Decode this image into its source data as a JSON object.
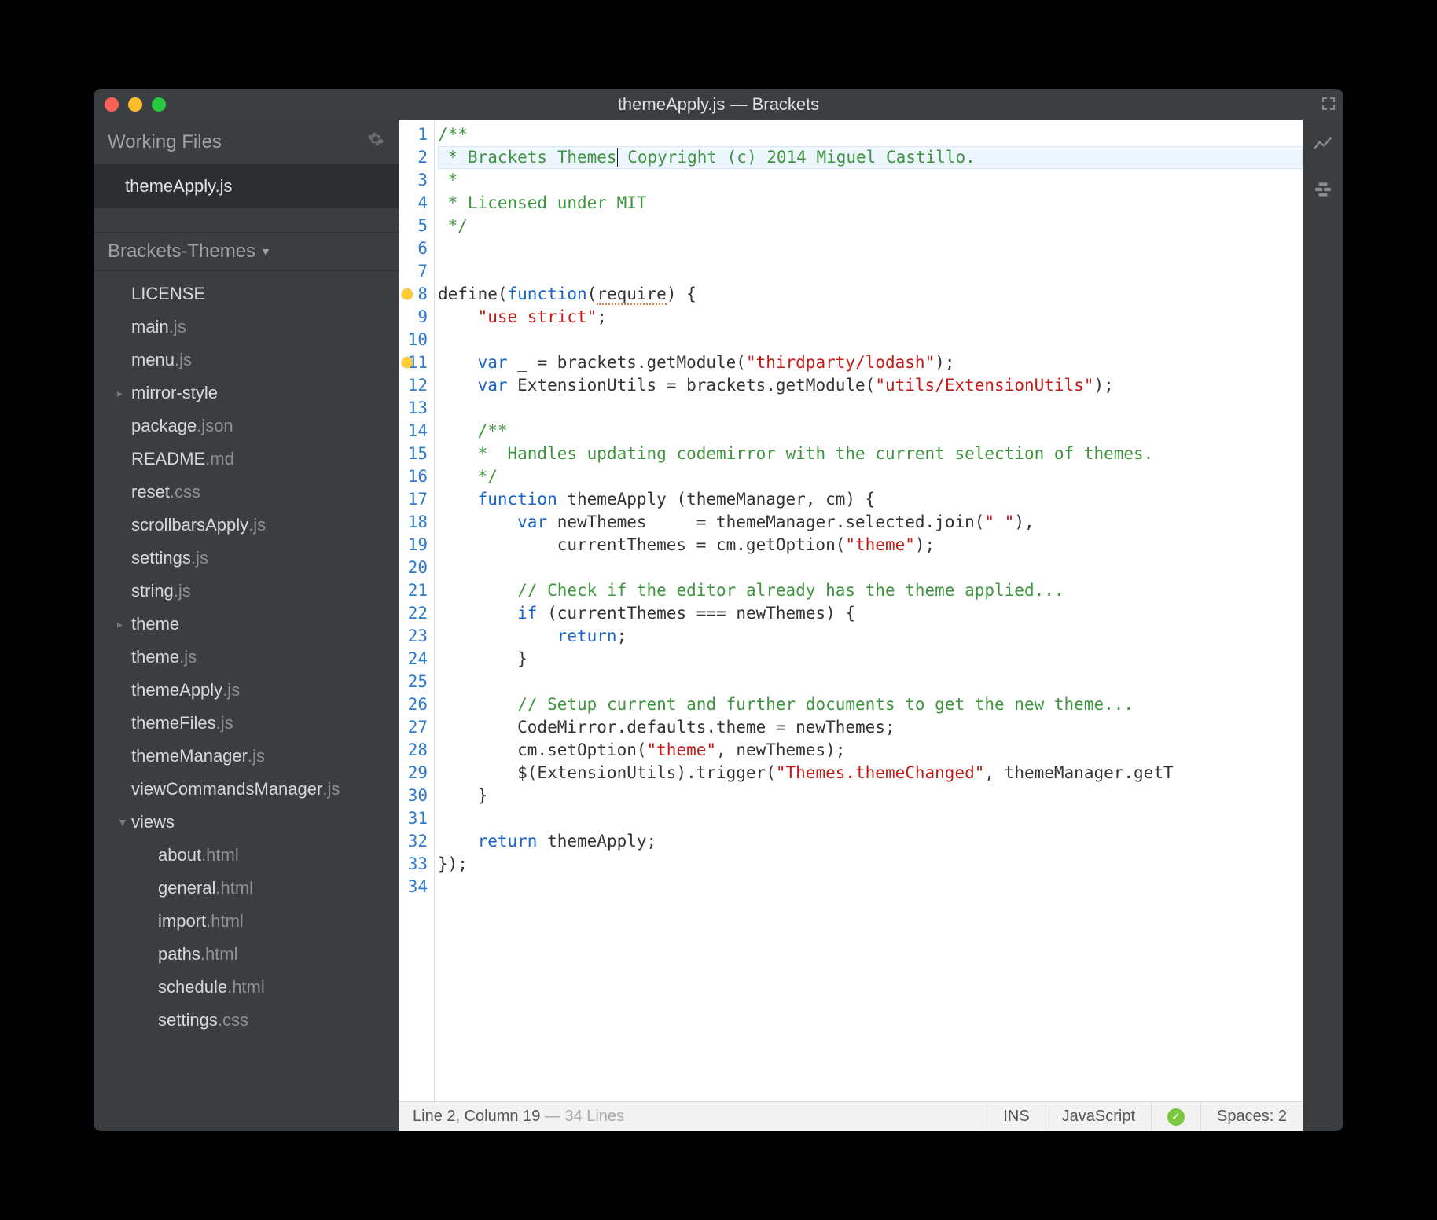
{
  "window": {
    "title": "themeApply.js — Brackets"
  },
  "working": {
    "header": "Working Files",
    "file": "themeApply.js"
  },
  "project": {
    "name": "Brackets-Themes"
  },
  "tree": [
    {
      "type": "file",
      "base": "LICENSE",
      "ext": "",
      "depth": 1
    },
    {
      "type": "file",
      "base": "main",
      "ext": ".js",
      "depth": 1
    },
    {
      "type": "file",
      "base": "menu",
      "ext": ".js",
      "depth": 1
    },
    {
      "type": "folder",
      "base": "mirror-style",
      "ext": "",
      "depth": 1,
      "state": "collapsed"
    },
    {
      "type": "file",
      "base": "package",
      "ext": ".json",
      "depth": 1
    },
    {
      "type": "file",
      "base": "README",
      "ext": ".md",
      "depth": 1
    },
    {
      "type": "file",
      "base": "reset",
      "ext": ".css",
      "depth": 1
    },
    {
      "type": "file",
      "base": "scrollbarsApply",
      "ext": ".js",
      "depth": 1
    },
    {
      "type": "file",
      "base": "settings",
      "ext": ".js",
      "depth": 1
    },
    {
      "type": "file",
      "base": "string",
      "ext": ".js",
      "depth": 1
    },
    {
      "type": "folder",
      "base": "theme",
      "ext": "",
      "depth": 1,
      "state": "collapsed"
    },
    {
      "type": "file",
      "base": "theme",
      "ext": ".js",
      "depth": 1
    },
    {
      "type": "file",
      "base": "themeApply",
      "ext": ".js",
      "depth": 1
    },
    {
      "type": "file",
      "base": "themeFiles",
      "ext": ".js",
      "depth": 1
    },
    {
      "type": "file",
      "base": "themeManager",
      "ext": ".js",
      "depth": 1
    },
    {
      "type": "file",
      "base": "viewCommandsManager",
      "ext": ".js",
      "depth": 1
    },
    {
      "type": "folder",
      "base": "views",
      "ext": "",
      "depth": 1,
      "state": "expanded"
    },
    {
      "type": "file",
      "base": "about",
      "ext": ".html",
      "depth": 2
    },
    {
      "type": "file",
      "base": "general",
      "ext": ".html",
      "depth": 2
    },
    {
      "type": "file",
      "base": "import",
      "ext": ".html",
      "depth": 2
    },
    {
      "type": "file",
      "base": "paths",
      "ext": ".html",
      "depth": 2
    },
    {
      "type": "file",
      "base": "schedule",
      "ext": ".html",
      "depth": 2
    },
    {
      "type": "file",
      "base": "settings",
      "ext": ".css",
      "depth": 2
    }
  ],
  "code": {
    "activeLine": 2,
    "hints": [
      8,
      11
    ],
    "lines": [
      {
        "n": 1,
        "t": [
          [
            "comment",
            "/**"
          ]
        ]
      },
      {
        "n": 2,
        "t": [
          [
            "comment",
            " * Brackets Themes"
          ],
          [
            "cursor",
            ""
          ],
          [
            "comment",
            " Copyright (c) 2014 Miguel Castillo."
          ]
        ]
      },
      {
        "n": 3,
        "t": [
          [
            "comment",
            " *"
          ]
        ]
      },
      {
        "n": 4,
        "t": [
          [
            "comment",
            " * Licensed under MIT"
          ]
        ]
      },
      {
        "n": 5,
        "t": [
          [
            "comment",
            " */"
          ]
        ]
      },
      {
        "n": 6,
        "t": []
      },
      {
        "n": 7,
        "t": []
      },
      {
        "n": 8,
        "t": [
          [
            "def",
            "define("
          ],
          [
            "kw",
            "function"
          ],
          [
            "def",
            "("
          ],
          [
            "spellerr",
            "require"
          ],
          [
            "def",
            ") {"
          ]
        ]
      },
      {
        "n": 9,
        "t": [
          [
            "def",
            "    "
          ],
          [
            "str",
            "\"use strict\""
          ],
          [
            "def",
            ";"
          ]
        ]
      },
      {
        "n": 10,
        "t": []
      },
      {
        "n": 11,
        "t": [
          [
            "def",
            "    "
          ],
          [
            "kw",
            "var"
          ],
          [
            "def",
            " _ = brackets.getModule("
          ],
          [
            "str",
            "\"thirdparty/lodash\""
          ],
          [
            "def",
            ");"
          ]
        ]
      },
      {
        "n": 12,
        "t": [
          [
            "def",
            "    "
          ],
          [
            "kw",
            "var"
          ],
          [
            "def",
            " ExtensionUtils = brackets.getModule("
          ],
          [
            "str",
            "\"utils/ExtensionUtils\""
          ],
          [
            "def",
            ");"
          ]
        ]
      },
      {
        "n": 13,
        "t": []
      },
      {
        "n": 14,
        "t": [
          [
            "def",
            "    "
          ],
          [
            "comment",
            "/**"
          ]
        ]
      },
      {
        "n": 15,
        "t": [
          [
            "def",
            "    "
          ],
          [
            "comment",
            "*  Handles updating codemirror with the current selection of themes."
          ]
        ]
      },
      {
        "n": 16,
        "t": [
          [
            "def",
            "    "
          ],
          [
            "comment",
            "*/"
          ]
        ]
      },
      {
        "n": 17,
        "t": [
          [
            "def",
            "    "
          ],
          [
            "kw",
            "function"
          ],
          [
            "def",
            " themeApply (themeManager, cm) {"
          ]
        ]
      },
      {
        "n": 18,
        "t": [
          [
            "def",
            "        "
          ],
          [
            "kw",
            "var"
          ],
          [
            "def",
            " newThemes     = themeManager.selected.join("
          ],
          [
            "str",
            "\" \""
          ],
          [
            "def",
            "),"
          ]
        ]
      },
      {
        "n": 19,
        "t": [
          [
            "def",
            "            currentThemes = cm.getOption("
          ],
          [
            "str",
            "\"theme\""
          ],
          [
            "def",
            ");"
          ]
        ]
      },
      {
        "n": 20,
        "t": []
      },
      {
        "n": 21,
        "t": [
          [
            "def",
            "        "
          ],
          [
            "comment",
            "// Check if the editor already has the theme applied..."
          ]
        ]
      },
      {
        "n": 22,
        "t": [
          [
            "def",
            "        "
          ],
          [
            "kw",
            "if"
          ],
          [
            "def",
            " (currentThemes === newThemes) {"
          ]
        ]
      },
      {
        "n": 23,
        "t": [
          [
            "def",
            "            "
          ],
          [
            "kw",
            "return"
          ],
          [
            "def",
            ";"
          ]
        ]
      },
      {
        "n": 24,
        "t": [
          [
            "def",
            "        }"
          ]
        ]
      },
      {
        "n": 25,
        "t": []
      },
      {
        "n": 26,
        "t": [
          [
            "def",
            "        "
          ],
          [
            "comment",
            "// Setup current and further documents to get the new theme..."
          ]
        ]
      },
      {
        "n": 27,
        "t": [
          [
            "def",
            "        CodeMirror.defaults.theme = newThemes;"
          ]
        ]
      },
      {
        "n": 28,
        "t": [
          [
            "def",
            "        cm.setOption("
          ],
          [
            "str",
            "\"theme\""
          ],
          [
            "def",
            ", newThemes);"
          ]
        ]
      },
      {
        "n": 29,
        "t": [
          [
            "def",
            "        $(ExtensionUtils).trigger("
          ],
          [
            "str",
            "\"Themes.themeChanged\""
          ],
          [
            "def",
            ", themeManager.getT"
          ]
        ]
      },
      {
        "n": 30,
        "t": [
          [
            "def",
            "    }"
          ]
        ]
      },
      {
        "n": 31,
        "t": []
      },
      {
        "n": 32,
        "t": [
          [
            "def",
            "    "
          ],
          [
            "kw",
            "return"
          ],
          [
            "def",
            " themeApply;"
          ]
        ]
      },
      {
        "n": 33,
        "t": [
          [
            "def",
            "});"
          ]
        ]
      },
      {
        "n": 34,
        "t": []
      }
    ]
  },
  "status": {
    "cursor": "Line 2, Column 19",
    "lines": " — 34 Lines",
    "ins": "INS",
    "lang": "JavaScript",
    "spaces": "Spaces: 2"
  }
}
